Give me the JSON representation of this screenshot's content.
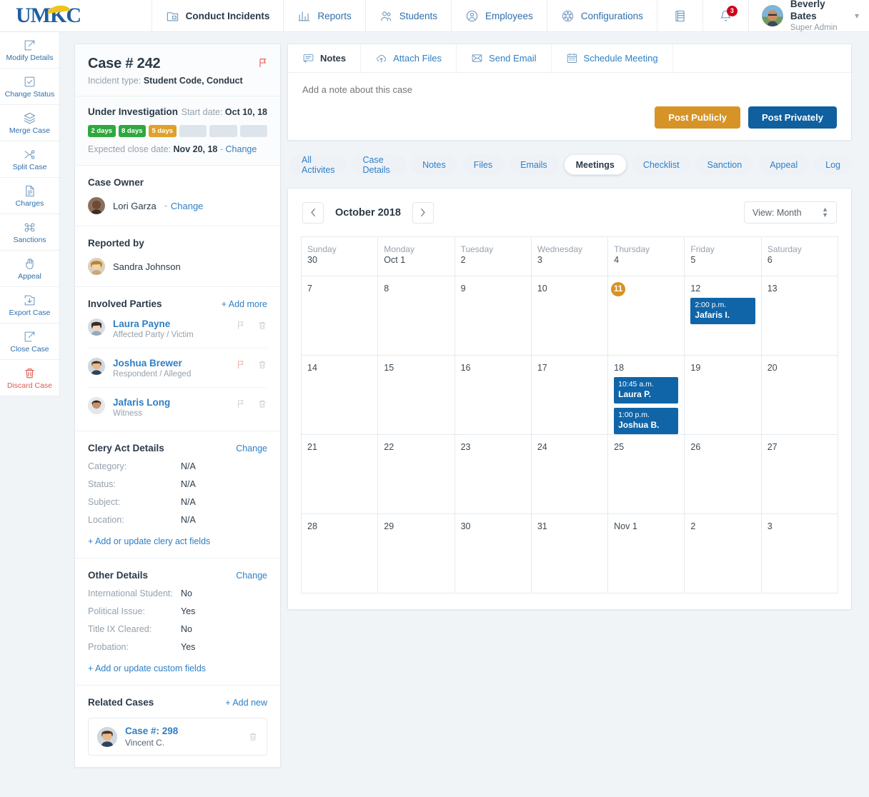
{
  "topbar": {
    "logo_text": "UMKC",
    "nav": [
      {
        "label": "Conduct Incidents",
        "icon": "folder-icon",
        "active": true
      },
      {
        "label": "Reports",
        "icon": "chart-icon",
        "active": false
      },
      {
        "label": "Students",
        "icon": "students-icon",
        "active": false
      },
      {
        "label": "Employees",
        "icon": "employees-icon",
        "active": false
      },
      {
        "label": "Configurations",
        "icon": "gear-icon",
        "active": false
      }
    ],
    "book_icon": "book-icon",
    "bell_icon": "bell-icon",
    "notification_count": "3",
    "user": {
      "name": "Beverly Bates",
      "role": "Super Admin",
      "avatar": "user-avatar",
      "caret": "chevron-down-icon"
    }
  },
  "rail": {
    "items": [
      {
        "label": "Modify Details",
        "icon": "pencil-square-icon",
        "danger": false
      },
      {
        "label": "Change Status",
        "icon": "check-square-icon",
        "danger": false
      },
      {
        "label": "Merge Case",
        "icon": "layers-icon",
        "danger": false
      },
      {
        "label": "Split Case",
        "icon": "split-icon",
        "danger": false
      },
      {
        "label": "Charges",
        "icon": "document-list-icon",
        "danger": false
      },
      {
        "label": "Sanctions",
        "icon": "command-icon",
        "danger": false
      },
      {
        "label": "Appeal",
        "icon": "hand-icon",
        "danger": false
      },
      {
        "label": "Export Case",
        "icon": "export-download-icon",
        "danger": false
      },
      {
        "label": "Close Case",
        "icon": "pencil-square-icon",
        "danger": false
      },
      {
        "label": "Discard Case",
        "icon": "trash-icon",
        "danger": true
      }
    ]
  },
  "case": {
    "title": "Case # 242",
    "incident_label": "Incident type:",
    "incident_type": "Student Code, Conduct",
    "flag_icon": "flag-icon",
    "status": {
      "name": "Under Investigation",
      "start_label": "Start date:",
      "start_date": "Oct 10, 18",
      "pills": [
        {
          "label": "2 days",
          "color": "green"
        },
        {
          "label": "8 days",
          "color": "green"
        },
        {
          "label": "5 days",
          "color": "orange"
        },
        {
          "label": "",
          "color": "empty"
        },
        {
          "label": "",
          "color": "empty"
        },
        {
          "label": "",
          "color": "empty"
        }
      ],
      "close_label": "Expected close date:",
      "close_date": "Nov 20, 18",
      "close_sep": "-",
      "change_label": "Change"
    },
    "owner": {
      "heading": "Case Owner",
      "name": "Lori Garza",
      "sep": "-",
      "change_label": "Change"
    },
    "reporter": {
      "heading": "Reported by",
      "name": "Sandra Johnson"
    },
    "involved": {
      "heading": "Involved Parties",
      "add_label": "+ Add more",
      "parties": [
        {
          "name": "Laura Payne",
          "role": "Affected Party / Victim",
          "flagged": false
        },
        {
          "name": "Joshua Brewer",
          "role": "Respondent / Alleged",
          "flagged": true
        },
        {
          "name": "Jafaris Long",
          "role": "Witness",
          "flagged": false
        }
      ]
    },
    "clery": {
      "heading": "Clery Act Details",
      "change_label": "Change",
      "fields": [
        {
          "key": "Category:",
          "value": "N/A"
        },
        {
          "key": "Status:",
          "value": "N/A"
        },
        {
          "key": "Subject:",
          "value": "N/A"
        },
        {
          "key": "Location:",
          "value": "N/A"
        }
      ],
      "add_label": "+ Add or update clery act fields"
    },
    "other": {
      "heading": "Other Details",
      "change_label": "Change",
      "fields": [
        {
          "key": "International Student:",
          "value": "No"
        },
        {
          "key": "Political Issue:",
          "value": "Yes"
        },
        {
          "key": "Title IX Cleared:",
          "value": "No"
        },
        {
          "key": "Probation:",
          "value": "Yes"
        }
      ],
      "add_label": "+ Add or update custom fields"
    },
    "related": {
      "heading": "Related Cases",
      "add_label": "+ Add new",
      "items": [
        {
          "title": "Case #: 298",
          "person": "Vincent C."
        }
      ]
    }
  },
  "compose": {
    "tabs": [
      {
        "label": "Notes",
        "icon": "note-icon",
        "active": true
      },
      {
        "label": "Attach Files",
        "icon": "cloud-upload-icon",
        "active": false
      },
      {
        "label": "Send Email",
        "icon": "envelope-icon",
        "active": false
      },
      {
        "label": "Schedule Meeting",
        "icon": "calendar-icon",
        "active": false
      }
    ],
    "placeholder": "Add a note about this case",
    "value": "",
    "post_public_label": "Post Publicly",
    "post_private_label": "Post Privately"
  },
  "section_tabs": [
    {
      "label": "All Activites",
      "active": false
    },
    {
      "label": "Case Details",
      "active": false
    },
    {
      "label": "Notes",
      "active": false
    },
    {
      "label": "Files",
      "active": false
    },
    {
      "label": "Emails",
      "active": false
    },
    {
      "label": "Meetings",
      "active": true
    },
    {
      "label": "Checklist",
      "active": false
    },
    {
      "label": "Sanction",
      "active": false
    },
    {
      "label": "Appeal",
      "active": false
    },
    {
      "label": "Log",
      "active": false
    }
  ],
  "calendar": {
    "month_label": "October 2018",
    "prev_icon": "chevron-left-icon",
    "next_icon": "chevron-right-icon",
    "view_label": "View: Month",
    "daynames": [
      "Sunday",
      "Monday",
      "Tuesday",
      "Wednesday",
      "Thursday",
      "Friday",
      "Saturday"
    ],
    "weeks": [
      [
        {
          "num": "30",
          "today": false,
          "events": []
        },
        {
          "num": "Oct 1",
          "today": false,
          "events": []
        },
        {
          "num": "2",
          "today": false,
          "events": []
        },
        {
          "num": "3",
          "today": false,
          "events": []
        },
        {
          "num": "4",
          "today": false,
          "events": []
        },
        {
          "num": "5",
          "today": false,
          "events": []
        },
        {
          "num": "6",
          "today": false,
          "events": []
        }
      ],
      [
        {
          "num": "7",
          "today": false,
          "events": []
        },
        {
          "num": "8",
          "today": false,
          "events": []
        },
        {
          "num": "9",
          "today": false,
          "events": []
        },
        {
          "num": "10",
          "today": false,
          "events": []
        },
        {
          "num": "11",
          "today": true,
          "events": []
        },
        {
          "num": "12",
          "today": false,
          "events": [
            {
              "time": "2:00 p.m.",
              "name": "Jafaris I."
            }
          ]
        },
        {
          "num": "13",
          "today": false,
          "events": []
        }
      ],
      [
        {
          "num": "14",
          "today": false,
          "events": []
        },
        {
          "num": "15",
          "today": false,
          "events": []
        },
        {
          "num": "16",
          "today": false,
          "events": []
        },
        {
          "num": "17",
          "today": false,
          "events": []
        },
        {
          "num": "18",
          "today": false,
          "events": [
            {
              "time": "10:45 a.m.",
              "name": "Laura P."
            },
            {
              "time": "1:00 p.m.",
              "name": "Joshua B."
            }
          ]
        },
        {
          "num": "19",
          "today": false,
          "events": []
        },
        {
          "num": "20",
          "today": false,
          "events": []
        }
      ],
      [
        {
          "num": "21",
          "today": false,
          "events": []
        },
        {
          "num": "22",
          "today": false,
          "events": []
        },
        {
          "num": "23",
          "today": false,
          "events": []
        },
        {
          "num": "24",
          "today": false,
          "events": []
        },
        {
          "num": "25",
          "today": false,
          "events": []
        },
        {
          "num": "26",
          "today": false,
          "events": []
        },
        {
          "num": "27",
          "today": false,
          "events": []
        }
      ],
      [
        {
          "num": "28",
          "today": false,
          "events": []
        },
        {
          "num": "29",
          "today": false,
          "events": []
        },
        {
          "num": "30",
          "today": false,
          "events": []
        },
        {
          "num": "31",
          "today": false,
          "events": []
        },
        {
          "num": "Nov 1",
          "today": false,
          "events": []
        },
        {
          "num": "2",
          "today": false,
          "events": []
        },
        {
          "num": "3",
          "today": false,
          "events": []
        }
      ]
    ]
  },
  "colors": {
    "brand_blue": "#1f5fa0",
    "link_blue": "#2f7fc4",
    "event_blue": "#1065a8",
    "amber": "#d79326",
    "green": "#2fa83f",
    "danger_red": "#e2574c",
    "page_bg": "#f1f4f7"
  }
}
